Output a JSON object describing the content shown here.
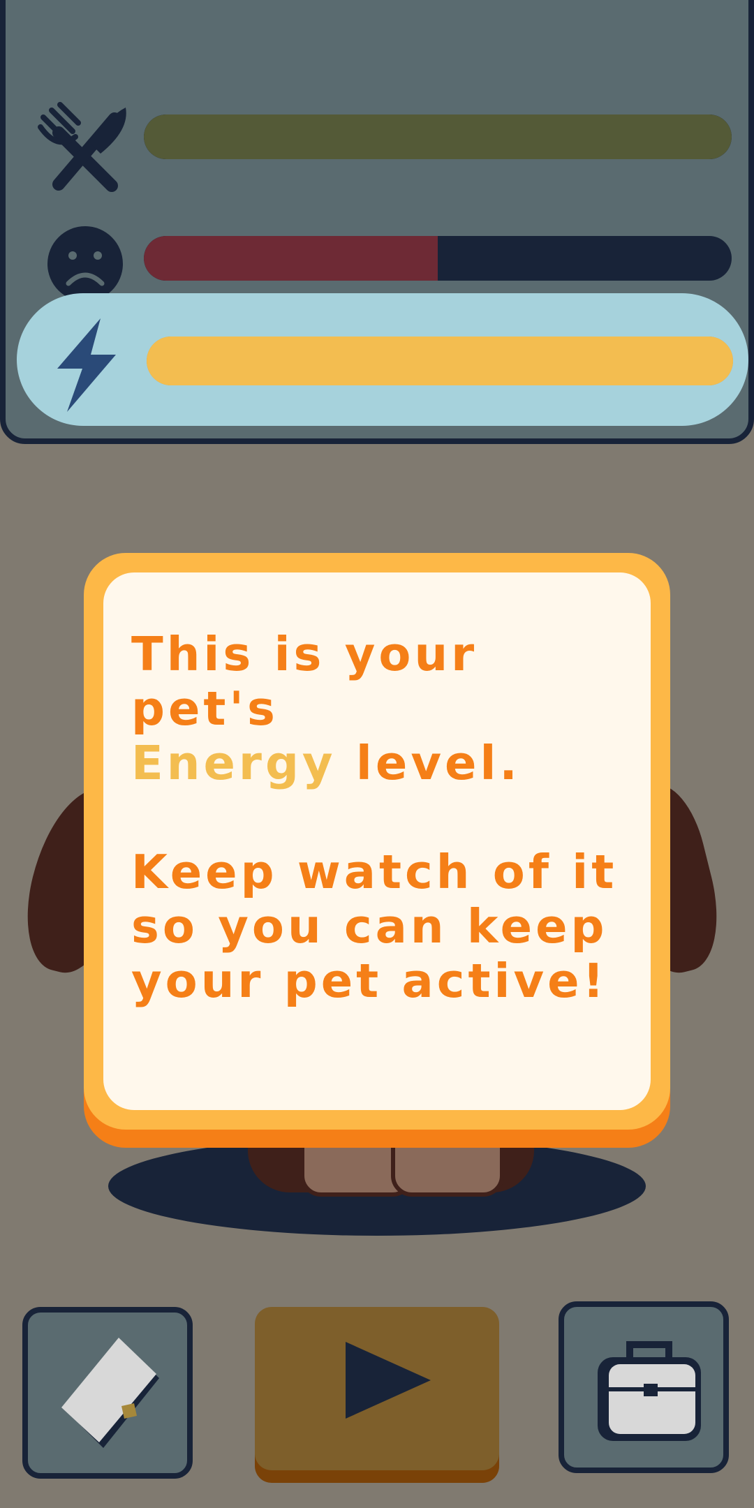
{
  "stats": {
    "hunger": {
      "icon": "fork-knife-icon",
      "level": 1.0,
      "color": "#545a37",
      "empty_color": "#182338"
    },
    "happiness": {
      "icon": "sad-face-icon",
      "level": 0.5,
      "color": "#6e2a35",
      "empty_color": "#182338"
    },
    "energy": {
      "icon": "lightning-bolt-icon",
      "level": 1.0,
      "color": "#f3bd50",
      "empty_color": "#182338",
      "highlighted": true
    }
  },
  "dialog": {
    "line1": "This is your pet's",
    "highlight": "Energy",
    "line2_rest": " level.",
    "line3": "Keep watch of it",
    "line4": "so you can keep",
    "line5": "your pet active!"
  },
  "bottom_bar": {
    "left_button_icon": "journal-icon",
    "center_button_icon": "play-icon",
    "right_button_icon": "bag-icon"
  },
  "colors": {
    "overlay_bg": "#807a70",
    "panel_border": "#182338",
    "dialog_text": "#f57f17",
    "dialog_highlight": "#f3bd50",
    "dialog_frame": "#fdb847"
  }
}
